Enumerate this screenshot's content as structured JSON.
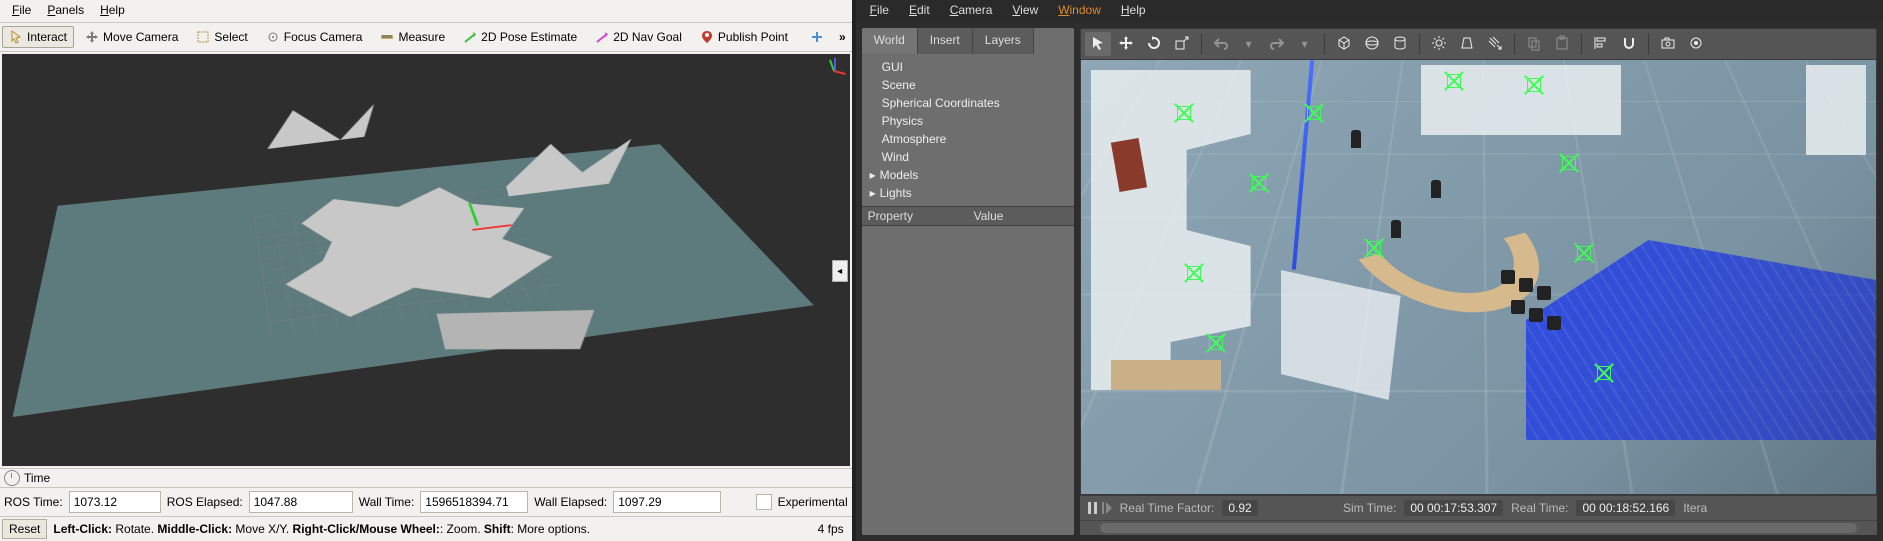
{
  "rviz": {
    "menu": {
      "file": "File",
      "panels": "Panels",
      "help": "Help"
    },
    "toolbar": {
      "interact": "Interact",
      "move_camera": "Move Camera",
      "select": "Select",
      "focus_camera": "Focus Camera",
      "measure": "Measure",
      "pose_estimate": "2D Pose Estimate",
      "nav_goal": "2D Nav Goal",
      "publish_point": "Publish Point",
      "overflow": "»"
    },
    "time_panel": {
      "header": "Time",
      "ros_time_label": "ROS Time:",
      "ros_time": "1073.12",
      "ros_elapsed_label": "ROS Elapsed:",
      "ros_elapsed": "1047.88",
      "wall_time_label": "Wall Time:",
      "wall_time": "1596518394.71",
      "wall_elapsed_label": "Wall Elapsed:",
      "wall_elapsed": "1097.29",
      "experimental": "Experimental"
    },
    "bottom": {
      "reset": "Reset",
      "hint_left_b": "Left-Click:",
      "hint_left_t": " Rotate. ",
      "hint_mid_b": "Middle-Click:",
      "hint_mid_t": " Move X/Y. ",
      "hint_right_b": "Right-Click/Mouse Wheel:",
      "hint_right_t": ": Zoom. ",
      "hint_shift_b": "Shift",
      "hint_shift_t": ": More options.",
      "fps": "4 fps"
    }
  },
  "gazebo": {
    "menu": {
      "file": "File",
      "edit": "Edit",
      "camera": "Camera",
      "view": "View",
      "window": "Window",
      "help": "Help"
    },
    "tabs": {
      "world": "World",
      "insert": "Insert",
      "layers": "Layers"
    },
    "tree": {
      "gui": "GUI",
      "scene": "Scene",
      "spherical": "Spherical Coordinates",
      "physics": "Physics",
      "atmosphere": "Atmosphere",
      "wind": "Wind",
      "models": "Models",
      "lights": "Lights"
    },
    "prop": {
      "property": "Property",
      "value": "Value"
    },
    "status": {
      "rtf_label": "Real Time Factor:",
      "rtf": "0.92",
      "sim_label": "Sim Time:",
      "sim": "00 00:17:53.307",
      "real_label": "Real Time:",
      "real": "00 00:18:52.166",
      "iter": "Itera"
    }
  }
}
